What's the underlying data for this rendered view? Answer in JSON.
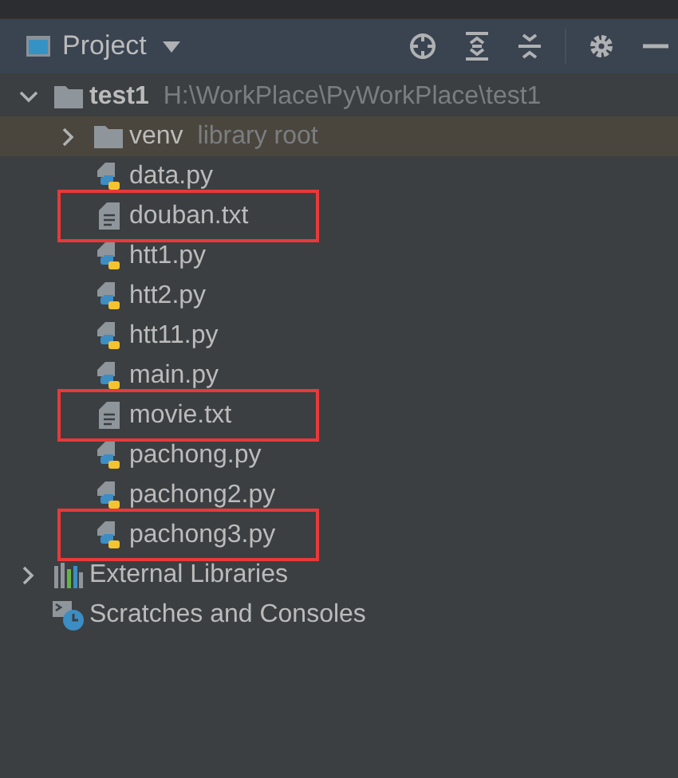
{
  "panel": {
    "title": "Project"
  },
  "tree": [
    {
      "kind": "folder",
      "name": "test1",
      "path": "H:\\WorkPlace\\PyWorkPlace\\test1",
      "expanded": true,
      "children": [
        {
          "kind": "folder",
          "name": "venv",
          "hint": "library root",
          "expanded": false,
          "selected": true
        },
        {
          "kind": "python",
          "name": "data.py",
          "marked": false,
          "selected": false
        },
        {
          "kind": "text",
          "name": "douban.txt",
          "marked": true,
          "selected": false
        },
        {
          "kind": "python",
          "name": "htt1.py",
          "marked": false,
          "selected": false
        },
        {
          "kind": "python",
          "name": "htt2.py",
          "marked": false,
          "selected": false
        },
        {
          "kind": "python",
          "name": "htt11.py",
          "marked": false,
          "selected": false
        },
        {
          "kind": "python",
          "name": "main.py",
          "marked": false,
          "selected": false
        },
        {
          "kind": "text",
          "name": "movie.txt",
          "marked": true,
          "selected": false
        },
        {
          "kind": "python",
          "name": "pachong.py",
          "marked": false,
          "selected": false
        },
        {
          "kind": "python",
          "name": "pachong2.py",
          "marked": false,
          "selected": false
        },
        {
          "kind": "python",
          "name": "pachong3.py",
          "marked": true,
          "selected": false
        }
      ]
    },
    {
      "kind": "libraries",
      "name": "External Libraries",
      "expanded": false
    },
    {
      "kind": "scratches",
      "name": "Scratches and Consoles"
    }
  ]
}
